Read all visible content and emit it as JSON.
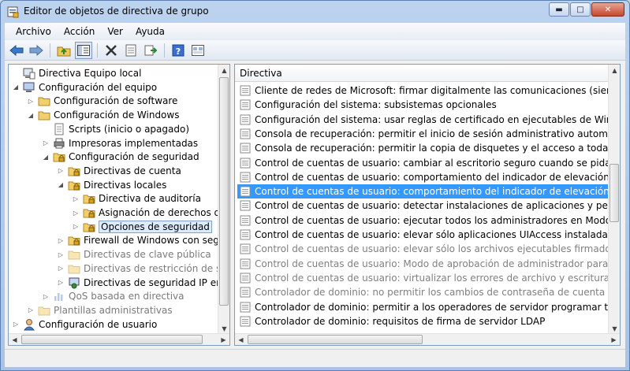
{
  "window": {
    "title": "Editor de objetos de directiva de grupo"
  },
  "menu": [
    {
      "label": "Archivo"
    },
    {
      "label": "Acción"
    },
    {
      "label": "Ver"
    },
    {
      "label": "Ayuda"
    }
  ],
  "toolbar": {
    "buttons": [
      "back-icon",
      "forward-icon",
      "up-folder-icon",
      "show-hide-tree-icon",
      "delete-icon",
      "properties-icon",
      "export-icon",
      "help-icon",
      "view-icon"
    ]
  },
  "tree": [
    {
      "label": "Directiva Equipo local",
      "depth": 0,
      "expander": "",
      "icon": "computer-policy",
      "dim": false,
      "selected": false
    },
    {
      "label": "Configuración del equipo",
      "depth": 0,
      "expander": "open",
      "icon": "computer",
      "dim": false,
      "selected": false
    },
    {
      "label": "Configuración de software",
      "depth": 1,
      "expander": "closed",
      "icon": "folder",
      "dim": false,
      "selected": false
    },
    {
      "label": "Configuración de Windows",
      "depth": 1,
      "expander": "open",
      "icon": "folder",
      "dim": false,
      "selected": false
    },
    {
      "label": "Scripts (inicio o apagado)",
      "depth": 2,
      "expander": "",
      "icon": "script",
      "dim": false,
      "selected": false
    },
    {
      "label": "Impresoras implementadas",
      "depth": 2,
      "expander": "closed",
      "icon": "printer",
      "dim": false,
      "selected": false
    },
    {
      "label": "Configuración de seguridad",
      "depth": 2,
      "expander": "open",
      "icon": "security-folder",
      "dim": false,
      "selected": false
    },
    {
      "label": "Directivas de cuenta",
      "depth": 3,
      "expander": "closed",
      "icon": "security-folder",
      "dim": false,
      "selected": false
    },
    {
      "label": "Directivas locales",
      "depth": 3,
      "expander": "open",
      "icon": "security-folder",
      "dim": false,
      "selected": false
    },
    {
      "label": "Directiva de auditoría",
      "depth": 4,
      "expander": "closed",
      "icon": "security-folder",
      "dim": false,
      "selected": false
    },
    {
      "label": "Asignación de derechos de",
      "depth": 4,
      "expander": "closed",
      "icon": "security-folder",
      "dim": false,
      "selected": false
    },
    {
      "label": "Opciones de seguridad",
      "depth": 4,
      "expander": "closed",
      "icon": "security-folder",
      "dim": false,
      "selected": true
    },
    {
      "label": "Firewall de Windows con segu",
      "depth": 3,
      "expander": "closed",
      "icon": "security-folder",
      "dim": false,
      "selected": false
    },
    {
      "label": "Directivas de clave pública",
      "depth": 3,
      "expander": "closed",
      "icon": "folder",
      "dim": true,
      "selected": false
    },
    {
      "label": "Directivas de restricción de sof",
      "depth": 3,
      "expander": "closed",
      "icon": "folder",
      "dim": true,
      "selected": false
    },
    {
      "label": "Directivas de seguridad IP en E",
      "depth": 3,
      "expander": "closed",
      "icon": "ipsec",
      "dim": false,
      "selected": false
    },
    {
      "label": "QoS basada en directiva",
      "depth": 2,
      "expander": "closed",
      "icon": "chart",
      "dim": true,
      "selected": false
    },
    {
      "label": "Plantillas administrativas",
      "depth": 1,
      "expander": "closed",
      "icon": "folder",
      "dim": true,
      "selected": false
    },
    {
      "label": "Configuración de usuario",
      "depth": 0,
      "expander": "closed",
      "icon": "user",
      "dim": false,
      "selected": false
    }
  ],
  "list": {
    "column_header": "Directiva",
    "rows": [
      {
        "label": "Cliente de redes de Microsoft: firmar digitalmente las comunicaciones (siempre)",
        "dim": false,
        "selected": false
      },
      {
        "label": "Configuración del sistema: subsistemas opcionales",
        "dim": false,
        "selected": false
      },
      {
        "label": "Configuración del sistema: usar reglas de certificado en ejecutables de Windows para d",
        "dim": false,
        "selected": false
      },
      {
        "label": "Consola de recuperación: permitir el inicio de sesión administrativo automático",
        "dim": false,
        "selected": false
      },
      {
        "label": "Consola de recuperación: permitir la copia de disquetes y el acceso a todas las unidades",
        "dim": false,
        "selected": false
      },
      {
        "label": "Control de cuentas de usuario: cambiar al escritorio seguro cuando se pida confirmació",
        "dim": false,
        "selected": false
      },
      {
        "label": "Control de cuentas de usuario: comportamiento del indicador de elevación para los adr",
        "dim": false,
        "selected": false
      },
      {
        "label": "Control de cuentas de usuario: comportamiento del indicador de elevación para los usu",
        "dim": false,
        "selected": true
      },
      {
        "label": "Control de cuentas de usuario: detectar instalaciones de aplicaciones y pedir confirmac",
        "dim": false,
        "selected": false
      },
      {
        "label": "Control de cuentas de usuario: ejecutar todos los administradores en Modo de aprobac",
        "dim": false,
        "selected": false
      },
      {
        "label": "Control de cuentas de usuario: elevar sólo aplicaciones UIAccess instaladas en ubicacio",
        "dim": false,
        "selected": false
      },
      {
        "label": "Control de cuentas de usuario: elevar sólo los archivos ejecutables firmados y validados",
        "dim": true,
        "selected": false
      },
      {
        "label": "Control de cuentas de usuario: Modo de aprobación de administrador para la cuenta Ad",
        "dim": true,
        "selected": false
      },
      {
        "label": "Control de cuentas de usuario: virtualizar los errores de archivo y escritura de Registro p",
        "dim": true,
        "selected": false
      },
      {
        "label": "Controlador de dominio: no permitir los cambios de contraseña de cuenta de equipo",
        "dim": true,
        "selected": false
      },
      {
        "label": "Controlador de dominio: permitir a los operadores de servidor programar tareas",
        "dim": false,
        "selected": false
      },
      {
        "label": "Controlador de dominio: requisitos de firma de servidor LDAP",
        "dim": false,
        "selected": false
      }
    ]
  },
  "colors": {
    "selection": "#3399ff",
    "tree_selection": "#dcebfc",
    "dim_text": "#808080"
  }
}
